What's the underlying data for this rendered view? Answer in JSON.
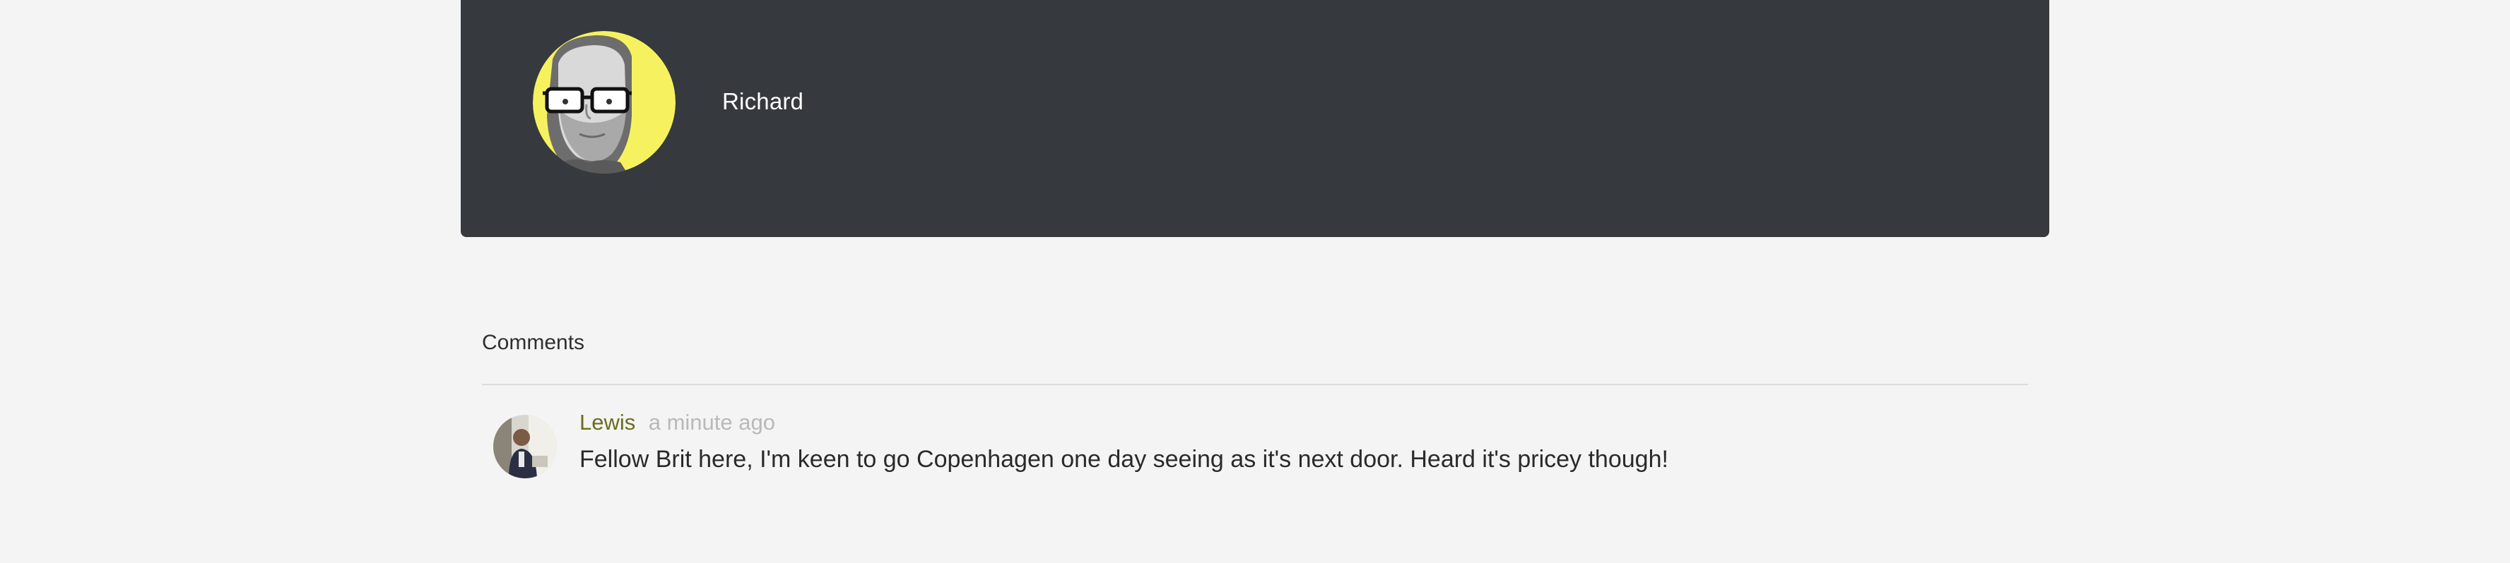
{
  "author": {
    "name": "Richard",
    "accent_color": "#f6f25f",
    "card_color": "#363a3e"
  },
  "comments": {
    "heading": "Comments",
    "items": [
      {
        "author": "Lewis",
        "time": "a minute ago",
        "text": "Fellow Brit here, I'm keen to go Copenhagen one day seeing as it's next door. Heard it's pricey though!"
      }
    ]
  }
}
